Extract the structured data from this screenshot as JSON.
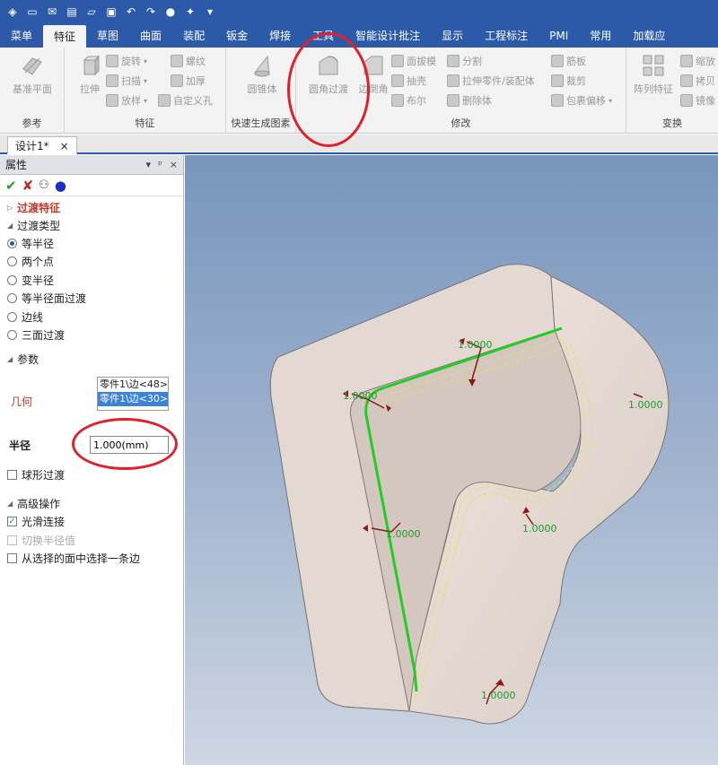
{
  "tabs": [
    "菜单",
    "特征",
    "草图",
    "曲面",
    "装配",
    "钣金",
    "焊接",
    "工具",
    "智能设计批注",
    "显示",
    "工程标注",
    "PMI",
    "常用",
    "加载应"
  ],
  "active_tab_index": 1,
  "ribbon": {
    "ref_group": {
      "label": "参考",
      "datum_plane": "基准平面"
    },
    "feature_group": {
      "label": "特征",
      "extrude": "拉伸",
      "revolve": "旋转",
      "thread": "螺纹",
      "sweep": "扫描",
      "thicken": "加厚",
      "loft": "放样",
      "custom_hole": "自定义孔"
    },
    "quick_group": {
      "label": "快速生成图素",
      "cone": "圆锥体"
    },
    "modify_group": {
      "label": "修改",
      "fillet": "圆角过渡",
      "chamfer": "边倒角",
      "face_draft": "面拔模",
      "shell": "抽壳",
      "boolean": "布尔",
      "split": "分割",
      "extrude_part": "拉伸零件/装配体",
      "delete_body": "删除体",
      "rib": "筋板",
      "trim": "裁剪",
      "wrap_offset": "包裹偏移"
    },
    "transform_group": {
      "label": "变换",
      "pattern": "阵列特征",
      "scale": "缩放",
      "copy": "拷贝",
      "mirror": "镜像"
    }
  },
  "doc_tab": {
    "title": "设计1*",
    "close": "×"
  },
  "panel": {
    "title": "属性",
    "controls": [
      "▾",
      "ᵖ",
      "×"
    ],
    "feature_title": "过渡特征",
    "type_section": "过渡类型",
    "types": [
      "等半径",
      "两个点",
      "变半径",
      "等半径面过渡",
      "边线",
      "三面过渡"
    ],
    "selected_type_index": 0,
    "params_section": "参数",
    "geometry_label": "几何",
    "geometry_items": [
      "零件1\\边<48>",
      "零件1\\边<30>"
    ],
    "selected_geometry_index": 1,
    "radius_label": "半径",
    "radius_value": "1.000(mm)",
    "ball_fillet": "球形过渡",
    "ball_fillet_checked": false,
    "advanced_section": "高级操作",
    "smooth_connect": "光滑连接",
    "smooth_connect_checked": true,
    "switch_radius": "切换半径值",
    "select_edge_from_face": "从选择的面中选择一条边",
    "select_edge_checked": false
  },
  "viewport": {
    "dim_labels": [
      "1.0000",
      "1.0000",
      "1.0000",
      "1.0000",
      "1.0000",
      "1.0000"
    ]
  },
  "colors": {
    "title_bar": "#2c5aa8",
    "highlight_edge": "#22cc22",
    "annotation": "#e0202a",
    "part_fill": "#d9cfc8"
  }
}
